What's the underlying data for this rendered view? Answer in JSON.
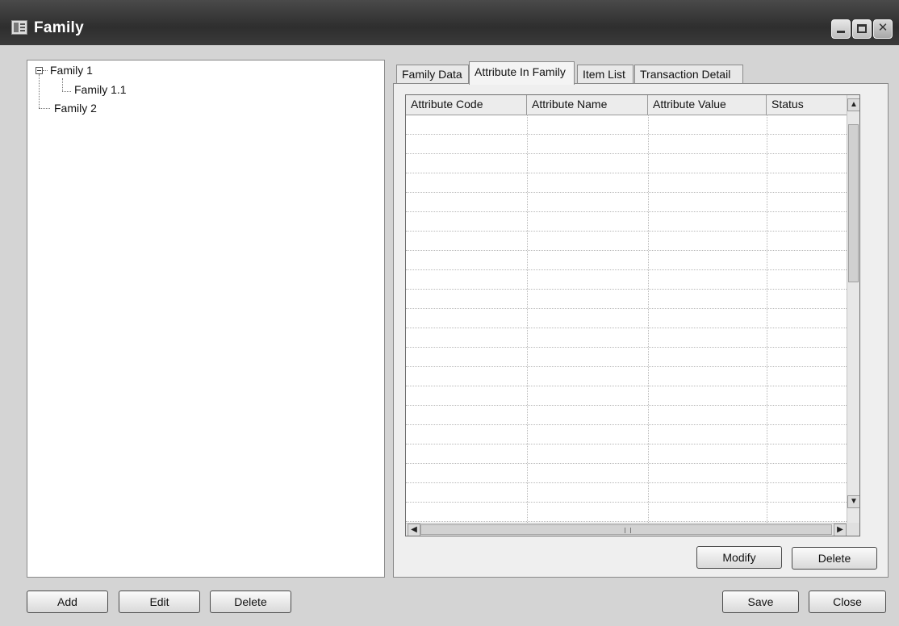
{
  "window": {
    "title": "Family"
  },
  "tree": {
    "nodes": [
      {
        "label": "Family 1"
      },
      {
        "label": "Family 1.1"
      },
      {
        "label": "Family 2"
      }
    ]
  },
  "tabs": [
    {
      "label": "Family Data"
    },
    {
      "label": "Attribute In Family",
      "selected": true
    },
    {
      "label": "Item List"
    },
    {
      "label": "Transaction Detail"
    }
  ],
  "grid": {
    "columns": [
      "Attribute Code",
      "Attribute Name",
      "Attribute Value",
      "Status"
    ],
    "rows": []
  },
  "buttons": {
    "modify": "Modify",
    "grid_delete": "Delete",
    "add": "Add",
    "edit": "Edit",
    "delete": "Delete",
    "save": "Save",
    "close": "Close"
  }
}
